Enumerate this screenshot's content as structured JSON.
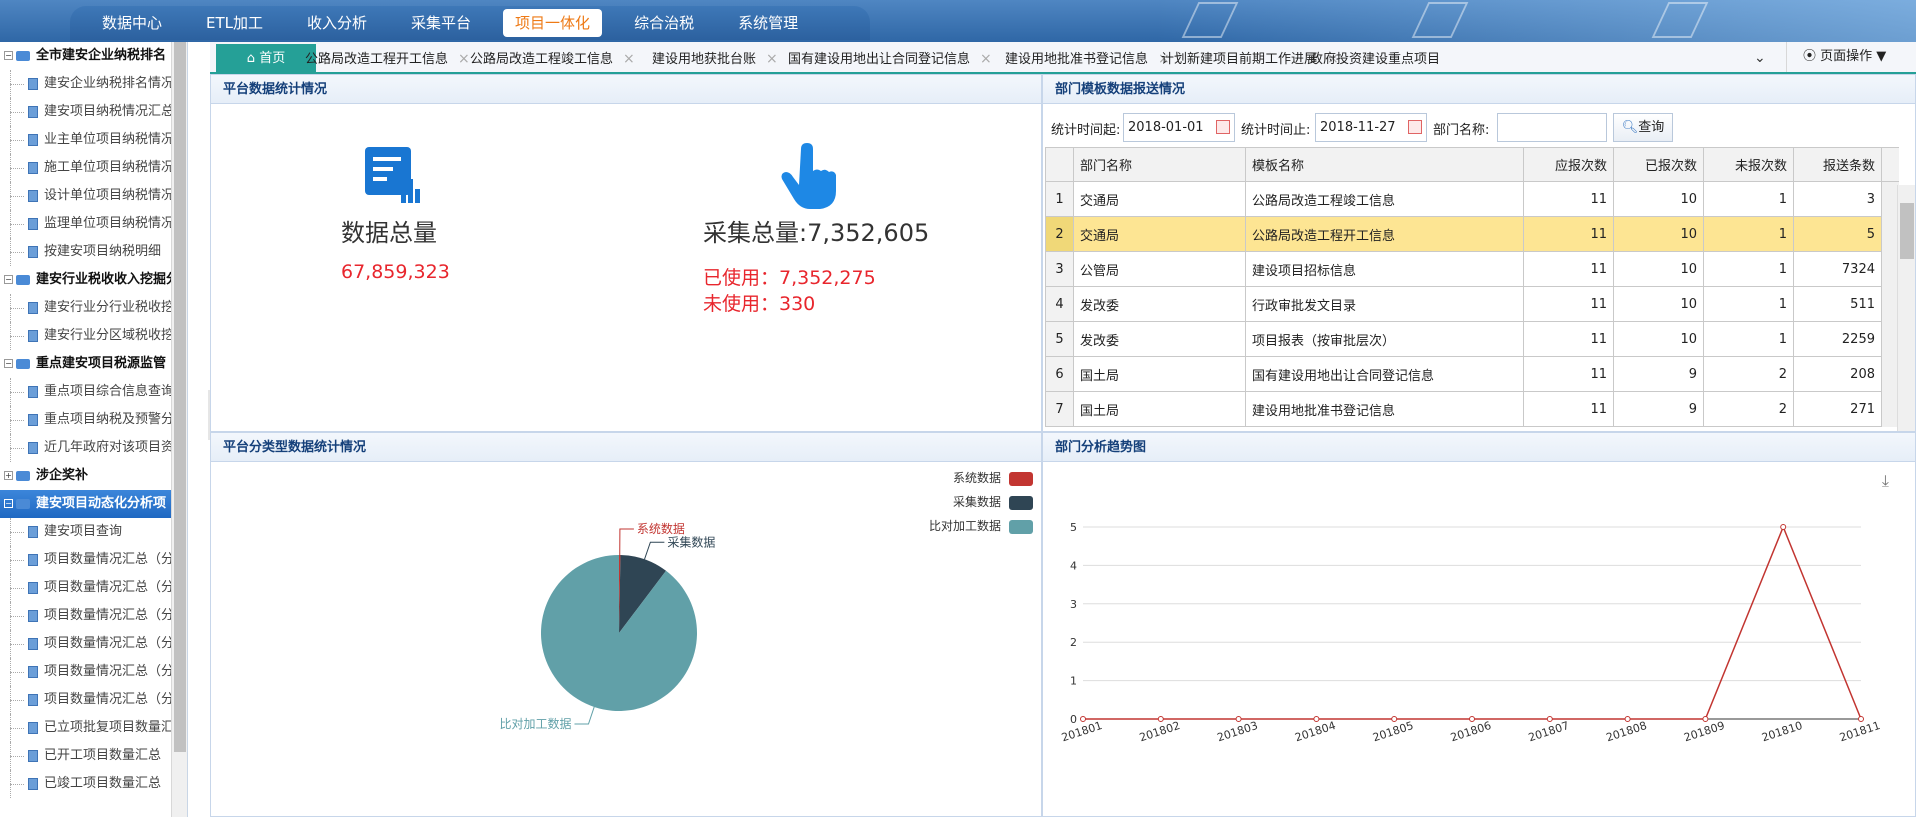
{
  "top_menu": [
    {
      "label": "数据中心",
      "active": false
    },
    {
      "label": "ETL加工",
      "active": false
    },
    {
      "label": "收入分析",
      "active": false
    },
    {
      "label": "采集平台",
      "active": false
    },
    {
      "label": "项目一体化",
      "active": true
    },
    {
      "label": "综合治税",
      "active": false
    },
    {
      "label": "系统管理",
      "active": false
    }
  ],
  "sidebar": [
    {
      "type": "group",
      "label": "全市建安企业纳税排名"
    },
    {
      "type": "leaf",
      "label": "建安企业纳税排名情况"
    },
    {
      "type": "leaf",
      "label": "建安项目纳税情况汇总"
    },
    {
      "type": "leaf",
      "label": "业主单位项目纳税情况"
    },
    {
      "type": "leaf",
      "label": "施工单位项目纳税情况"
    },
    {
      "type": "leaf",
      "label": "设计单位项目纳税情况"
    },
    {
      "type": "leaf",
      "label": "监理单位项目纳税情况"
    },
    {
      "type": "leaf",
      "label": "按建安项目纳税明细"
    },
    {
      "type": "group",
      "label": "建安行业税收收入挖掘分"
    },
    {
      "type": "leaf",
      "label": "建安行业分行业税收挖"
    },
    {
      "type": "leaf",
      "label": "建安行业分区域税收挖"
    },
    {
      "type": "group",
      "label": "重点建安项目税源监管"
    },
    {
      "type": "leaf",
      "label": "重点项目综合信息查询"
    },
    {
      "type": "leaf",
      "label": "重点项目纳税及预警分"
    },
    {
      "type": "leaf",
      "label": "近几年政府对该项目资"
    },
    {
      "type": "group",
      "label": "涉企奖补"
    },
    {
      "type": "group",
      "label": "建安项目动态化分析项",
      "selected": true
    },
    {
      "type": "leaf",
      "label": "建安项目查询"
    },
    {
      "type": "leaf",
      "label": "项目数量情况汇总（分"
    },
    {
      "type": "leaf",
      "label": "项目数量情况汇总（分"
    },
    {
      "type": "leaf",
      "label": "项目数量情况汇总（分"
    },
    {
      "type": "leaf",
      "label": "项目数量情况汇总（分"
    },
    {
      "type": "leaf",
      "label": "项目数量情况汇总（分"
    },
    {
      "type": "leaf",
      "label": "项目数量情况汇总（分"
    },
    {
      "type": "leaf",
      "label": "已立项批复项目数量汇"
    },
    {
      "type": "leaf",
      "label": "已开工项目数量汇总"
    },
    {
      "type": "leaf",
      "label": "已竣工项目数量汇总"
    }
  ],
  "tabs": {
    "home": "首页",
    "items": [
      "公路局改造工程开工信息",
      "公路局改造工程竣工信息",
      "建设用地获批台账",
      "国有建设用地出让合同登记信息",
      "建设用地批准书登记信息",
      "计划新建项目前期工作进展",
      "政府投资建设重点项目"
    ],
    "page_ops": "页面操作"
  },
  "panel_stats": {
    "title": "平台数据统计情况",
    "data_total_label": "数据总量",
    "data_total_value": "67,859,323",
    "collect_total_label": "采集总量:7,352,605",
    "used": "已使用：7,352,275",
    "unused": "未使用：330"
  },
  "panel_report": {
    "title": "部门模板数据报送情况",
    "start_label": "统计时间起:",
    "start_value": "2018-01-01",
    "end_label": "统计时间止:",
    "end_value": "2018-11-27",
    "dept_label": "部门名称:",
    "dept_value": "",
    "query_button": "查询",
    "columns": [
      "部门名称",
      "模板名称",
      "应报次数",
      "已报次数",
      "未报次数",
      "报送条数"
    ],
    "rows": [
      [
        "1",
        "交通局",
        "公路局改造工程竣工信息",
        "11",
        "10",
        "1",
        "3"
      ],
      [
        "2",
        "交通局",
        "公路局改造工程开工信息",
        "11",
        "10",
        "1",
        "5"
      ],
      [
        "3",
        "公管局",
        "建设项目招标信息",
        "11",
        "10",
        "1",
        "7324"
      ],
      [
        "4",
        "发改委",
        "行政审批发文目录",
        "11",
        "10",
        "1",
        "511"
      ],
      [
        "5",
        "发改委",
        "项目报表（按审批层次）",
        "11",
        "10",
        "1",
        "2259"
      ],
      [
        "6",
        "国土局",
        "国有建设用地出让合同登记信息",
        "11",
        "9",
        "2",
        "208"
      ],
      [
        "7",
        "国土局",
        "建设用地批准书登记信息",
        "11",
        "9",
        "2",
        "271"
      ]
    ],
    "highlight_row": 2
  },
  "chart_data": [
    {
      "type": "pie",
      "title": "平台分类型数据统计情况",
      "categories": [
        "系统数据",
        "采集数据",
        "比对加工数据"
      ],
      "values": [
        0.3,
        10,
        89.7
      ],
      "colors": [
        "#c23531",
        "#2f4554",
        "#61a0a8"
      ],
      "legend": "top-right"
    },
    {
      "type": "line",
      "title": "部门分析趋势图",
      "x": [
        "201801",
        "201802",
        "201803",
        "201804",
        "201805",
        "201806",
        "201807",
        "201808",
        "201809",
        "201810",
        "201811"
      ],
      "series": [
        {
          "values": [
            0,
            0,
            0,
            0,
            0,
            0,
            0,
            0,
            0,
            5,
            0
          ]
        }
      ],
      "ylim": [
        0,
        5
      ],
      "yticks": [
        0,
        1,
        2,
        3,
        4,
        5
      ],
      "color": "#c23531",
      "grid": true
    }
  ]
}
